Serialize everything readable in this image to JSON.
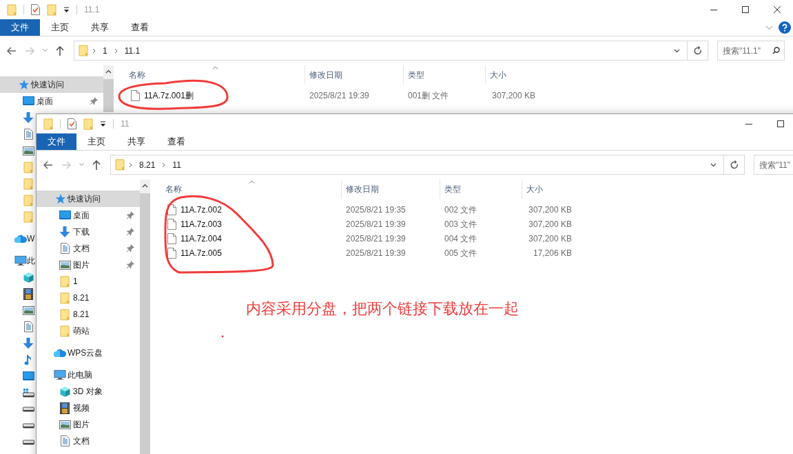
{
  "windows": [
    {
      "title": "11.1",
      "ribbon_tabs": [
        {
          "label": "文件",
          "selected": true
        },
        {
          "label": "主页",
          "selected": false
        },
        {
          "label": "共享",
          "selected": false
        },
        {
          "label": "查看",
          "selected": false
        }
      ],
      "breadcrumb": [
        "1",
        "11.1"
      ],
      "search": {
        "placeholder": "搜索\"11.1\""
      },
      "nav": [
        {
          "label": "快速访问",
          "kind": "star",
          "selected": true,
          "children": [
            {
              "label": "桌面",
              "kind": "desktop",
              "pinned": true,
              "selected": false
            },
            {
              "kind": "download",
              "selected": false
            },
            {
              "kind": "doc",
              "selected": false
            },
            {
              "kind": "picture",
              "selected": false
            },
            {
              "kind": "folder",
              "selected": false
            },
            {
              "kind": "folder",
              "selected": false
            },
            {
              "kind": "folder",
              "selected": false
            },
            {
              "kind": "folder",
              "selected": false
            }
          ]
        },
        {
          "label": "W",
          "kind": "cloud",
          "selected": false
        },
        {
          "label": "此",
          "kind": "pc",
          "selected": false,
          "children": [
            {
              "kind": "cube",
              "selected": false
            },
            {
              "kind": "film",
              "selected": false
            },
            {
              "kind": "picture",
              "selected": false
            },
            {
              "kind": "doc",
              "selected": false
            },
            {
              "kind": "download",
              "selected": false
            },
            {
              "kind": "music",
              "selected": false
            },
            {
              "kind": "desktop",
              "selected": false
            },
            {
              "kind": "drive-win",
              "selected": false
            },
            {
              "kind": "drive",
              "selected": false
            },
            {
              "kind": "drive",
              "selected": false
            },
            {
              "kind": "drive",
              "selected": false
            }
          ]
        }
      ],
      "columns": [
        "名称",
        "修改日期",
        "类型",
        "大小"
      ],
      "files": [
        {
          "name": "11A.7z.001删",
          "modified": "2025/8/21 19:39",
          "type": "001删 文件",
          "size": "307,200 KB"
        }
      ]
    },
    {
      "title": "11",
      "ribbon_tabs": [
        {
          "label": "文件",
          "selected": true
        },
        {
          "label": "主页",
          "selected": false
        },
        {
          "label": "共享",
          "selected": false
        },
        {
          "label": "查看",
          "selected": false
        }
      ],
      "breadcrumb": [
        "8.21",
        "11"
      ],
      "search": {
        "placeholder": "搜索\"11\""
      },
      "nav": [
        {
          "label": "快速访问",
          "kind": "star",
          "selected": true,
          "children": [
            {
              "label": "桌面",
              "kind": "desktop",
              "pinned": true,
              "selected": false
            },
            {
              "label": "下载",
              "kind": "download",
              "pinned": true,
              "selected": false
            },
            {
              "label": "文档",
              "kind": "doc",
              "pinned": true,
              "selected": false
            },
            {
              "label": "图片",
              "kind": "picture",
              "pinned": true,
              "selected": false
            },
            {
              "label": "1",
              "kind": "folder",
              "pinned": false,
              "selected": false
            },
            {
              "label": "8.21",
              "kind": "folder",
              "pinned": false,
              "selected": false
            },
            {
              "label": "8.21",
              "kind": "folder",
              "pinned": false,
              "selected": false
            },
            {
              "label": "萌站",
              "kind": "folder",
              "pinned": false,
              "selected": false
            }
          ]
        },
        {
          "label": "WPS云盘",
          "kind": "cloud",
          "selected": false
        },
        {
          "label": "此电脑",
          "kind": "pc",
          "selected": false,
          "children": [
            {
              "label": "3D 对象",
              "kind": "cube",
              "pinned": false,
              "selected": false
            },
            {
              "label": "视频",
              "kind": "film",
              "pinned": false,
              "selected": false
            },
            {
              "label": "图片",
              "kind": "picture",
              "pinned": false,
              "selected": false
            },
            {
              "label": "文档",
              "kind": "doc",
              "pinned": false,
              "selected": false
            }
          ]
        }
      ],
      "columns": [
        "名称",
        "修改日期",
        "类型",
        "大小"
      ],
      "files": [
        {
          "name": "11A.7z.002",
          "modified": "2025/8/21 19:35",
          "type": "002 文件",
          "size": "307,200 KB"
        },
        {
          "name": "11A.7z.003",
          "modified": "2025/8/21 19:39",
          "type": "003 文件",
          "size": "307,200 KB"
        },
        {
          "name": "11A.7z.004",
          "modified": "2025/8/21 19:39",
          "type": "004 文件",
          "size": "307,200 KB"
        },
        {
          "name": "11A.7z.005",
          "modified": "2025/8/21 19:39",
          "type": "005 文件",
          "size": "17,206 KB"
        }
      ]
    }
  ],
  "annotation": {
    "text": "内容采用分盘，把两个链接下载放在一起"
  }
}
